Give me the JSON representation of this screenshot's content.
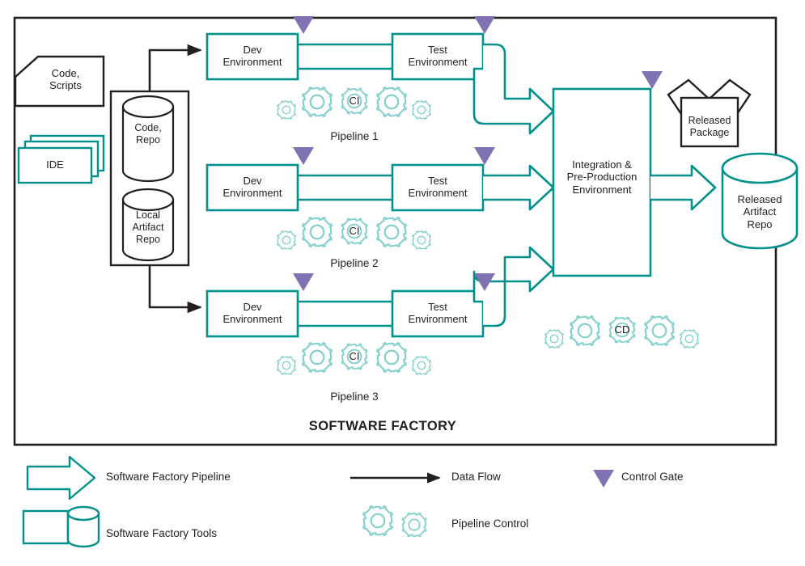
{
  "diagram": {
    "title": "SOFTWARE FACTORY",
    "colors": {
      "teal": "#00918C",
      "teal_light": "#7FCFCB",
      "purple": "#8272B4",
      "black": "#231f20",
      "background": "#ffffff"
    },
    "inputs": [
      {
        "name": "code-scripts",
        "label": "Code,\nScripts",
        "shape": "document",
        "color": "#231f20"
      },
      {
        "name": "ide",
        "label": "IDE",
        "shape": "stacked-rectangles",
        "color": "#00918C"
      }
    ],
    "repositories": [
      {
        "name": "code-repo",
        "label": "Code,\nRepo",
        "shape": "cylinder",
        "color": "#231f20"
      },
      {
        "name": "local-artifact-repo",
        "label": "Local\nArtifact\nRepo",
        "shape": "cylinder",
        "color": "#231f20"
      }
    ],
    "pipelines": [
      {
        "label": "Pipeline 1",
        "dev": "Dev\nEnvironment",
        "test": "Test\nEnvironment",
        "gear_label": "CI",
        "gates": 2
      },
      {
        "label": "Pipeline 2",
        "dev": "Dev\nEnvironment",
        "test": "Test\nEnvironment",
        "gear_label": "CI",
        "gates": 2
      },
      {
        "label": "Pipeline 3",
        "dev": "Dev\nEnvironment",
        "test": "Test\nEnvironment",
        "gear_label": "CI",
        "gates": 2
      }
    ],
    "integration": {
      "label": "Integration &\nPre-Production\nEnvironment",
      "gear_label": "CD",
      "gates": 1
    },
    "outputs": [
      {
        "name": "released-package",
        "label": "Released\nPackage",
        "shape": "open-box",
        "color": "#231f20"
      },
      {
        "name": "released-artifact-repo",
        "label": "Released\nArtifact\nRepo",
        "shape": "cylinder",
        "color": "#00918C"
      }
    ],
    "legend": [
      {
        "name": "software-factory-pipeline",
        "label": "Software Factory Pipeline",
        "symbol": "hollow-arrow-icon"
      },
      {
        "name": "data-flow",
        "label": "Data Flow",
        "symbol": "line-arrow-icon"
      },
      {
        "name": "control-gate",
        "label": "Control Gate",
        "symbol": "down-triangle-icon"
      },
      {
        "name": "software-factory-tools",
        "label": "Software Factory Tools",
        "symbol": "box-cylinder-icon"
      },
      {
        "name": "pipeline-control",
        "label": "Pipeline Control",
        "symbol": "gears-icon"
      }
    ]
  }
}
